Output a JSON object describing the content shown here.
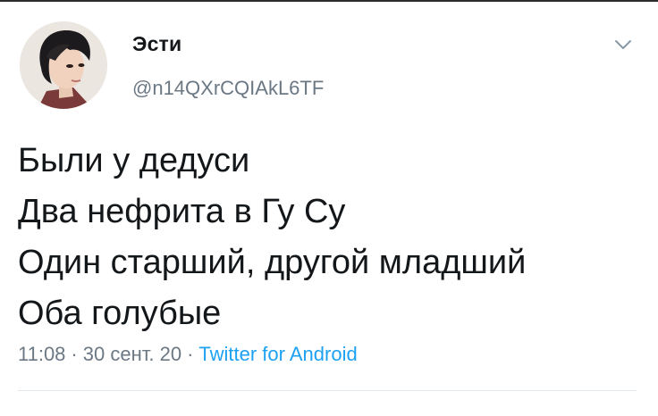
{
  "author": {
    "name": "Эсти",
    "handle": "@n14QXrCQIAkL6TF",
    "avatar_icon": "user-avatar-photo"
  },
  "tweet": {
    "lines": [
      "Были у дедуси",
      "Два нефрита в Гу Су",
      "Один старший, другой младший",
      "Оба голубые"
    ]
  },
  "meta": {
    "time": "11:08",
    "separator": "·",
    "date": "30 сент. 20",
    "source": "Twitter for Android"
  },
  "icons": {
    "menu": "chevron-down-icon"
  },
  "colors": {
    "text": "#14171a",
    "secondary": "#6b7884",
    "link": "#1da1f2",
    "divider": "#e1e8ed"
  }
}
